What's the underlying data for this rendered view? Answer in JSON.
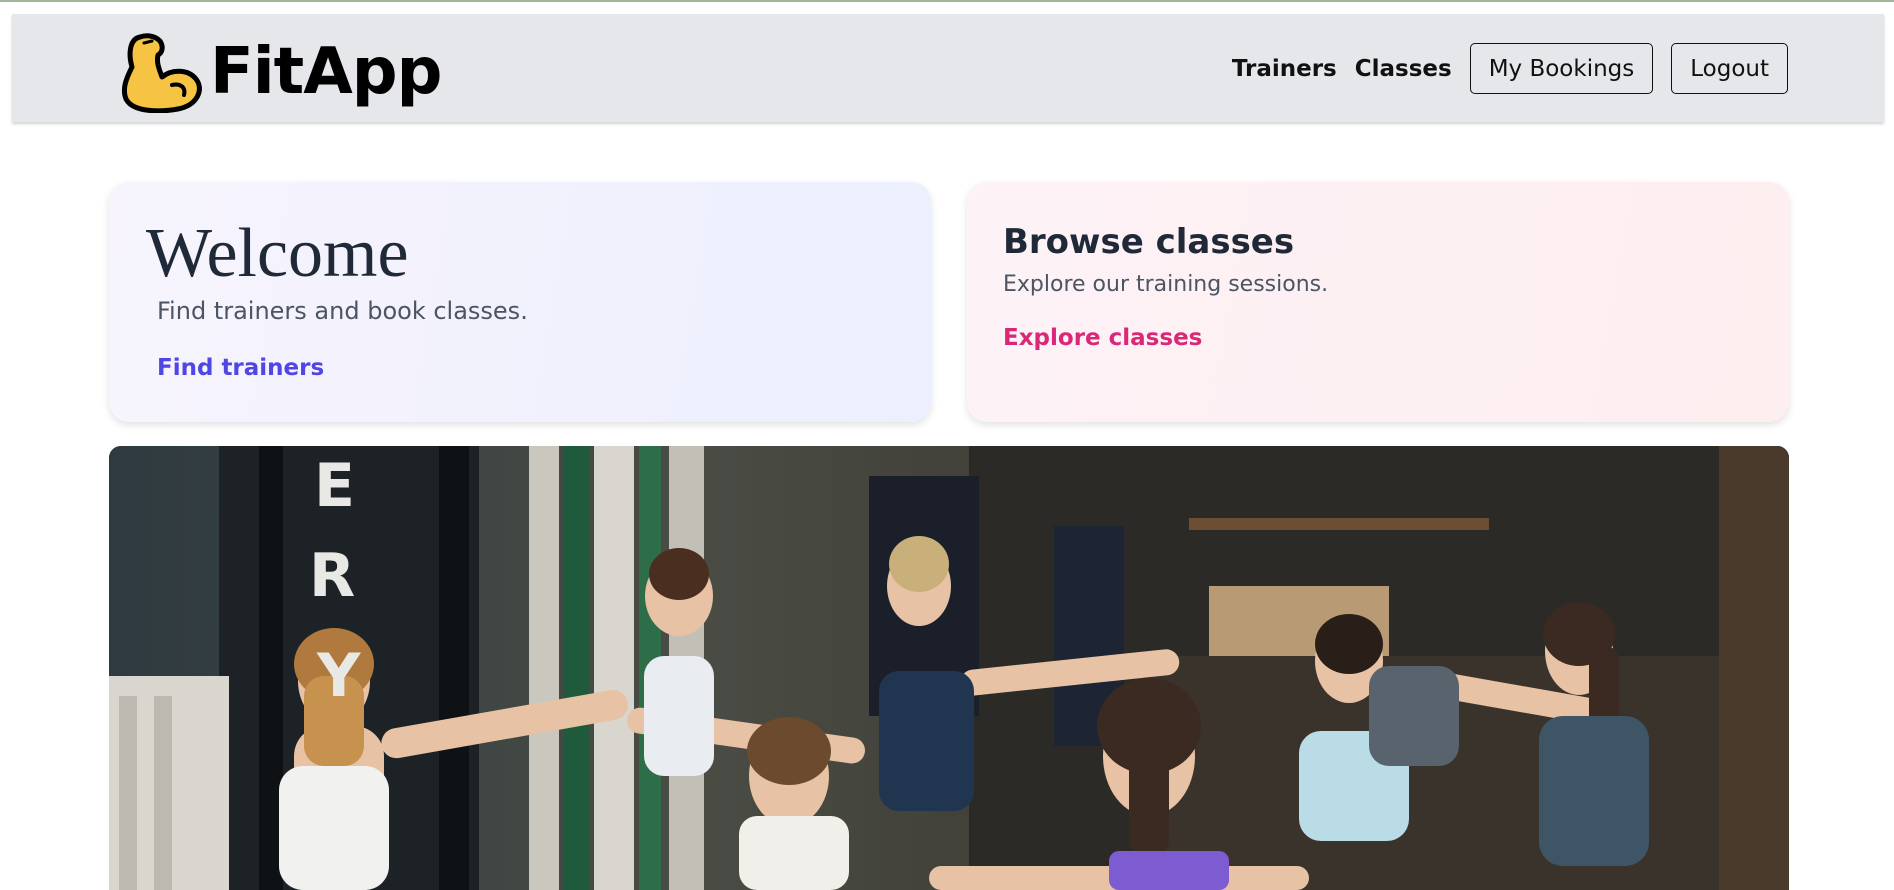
{
  "app": {
    "name": "FitApp",
    "logo_icon": "flexed-biceps-icon"
  },
  "nav": {
    "links": [
      "Trainers",
      "Classes"
    ],
    "bookings_label": "My Bookings",
    "logout_label": "Logout"
  },
  "welcome_card": {
    "title": "Welcome",
    "subtitle": "Find trainers and book classes.",
    "link": "Find trainers",
    "link_color": "#4f46e5"
  },
  "browse_card": {
    "title": "Browse classes",
    "subtitle": "Explore our training sessions.",
    "link": "Explore classes",
    "link_color": "#db2777"
  },
  "hero_image": {
    "subject": "group-yoga-class-photo"
  }
}
